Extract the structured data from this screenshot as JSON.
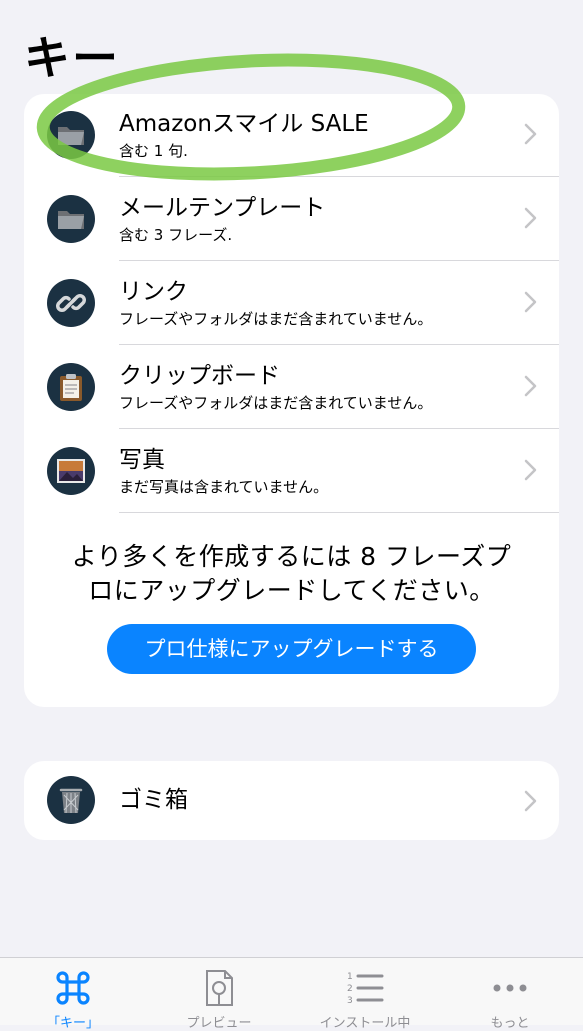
{
  "page": {
    "title": "キー"
  },
  "folders": [
    {
      "title": "Amazonスマイル SALE",
      "subtitle": "含む 1 句.",
      "icon": "folder-icon"
    },
    {
      "title": "メールテンプレート",
      "subtitle": "含む 3 フレーズ.",
      "icon": "folder-icon"
    },
    {
      "title": "リンク",
      "subtitle": "フレーズやフォルダはまだ含まれていません。",
      "icon": "link-icon"
    },
    {
      "title": "クリップボード",
      "subtitle": "フレーズやフォルダはまだ含まれていません。",
      "icon": "clipboard-icon"
    },
    {
      "title": "写真",
      "subtitle": "まだ写真は含まれていません。",
      "icon": "photo-icon"
    }
  ],
  "promo": {
    "line1": "より多くを作成するには 8 フレーズプ",
    "line2": "ロにアップグレードしてください。",
    "button_label": "プロ仕様にアップグレードする"
  },
  "trash": {
    "title": "ゴミ箱",
    "icon": "trash-icon"
  },
  "tabbar": {
    "tabs": [
      {
        "label": "「キー」",
        "icon": "command-icon",
        "active": true
      },
      {
        "label": "プレビュー",
        "icon": "preview-icon",
        "active": false
      },
      {
        "label": "インストール中",
        "icon": "numbered-list-icon",
        "active": false
      },
      {
        "label": "もっと",
        "icon": "more-icon",
        "active": false
      }
    ]
  },
  "colors": {
    "accent": "#0a84ff",
    "icon_bg": "#1b3142",
    "highlight": "#7ac943",
    "background": "#f2f2f7"
  }
}
